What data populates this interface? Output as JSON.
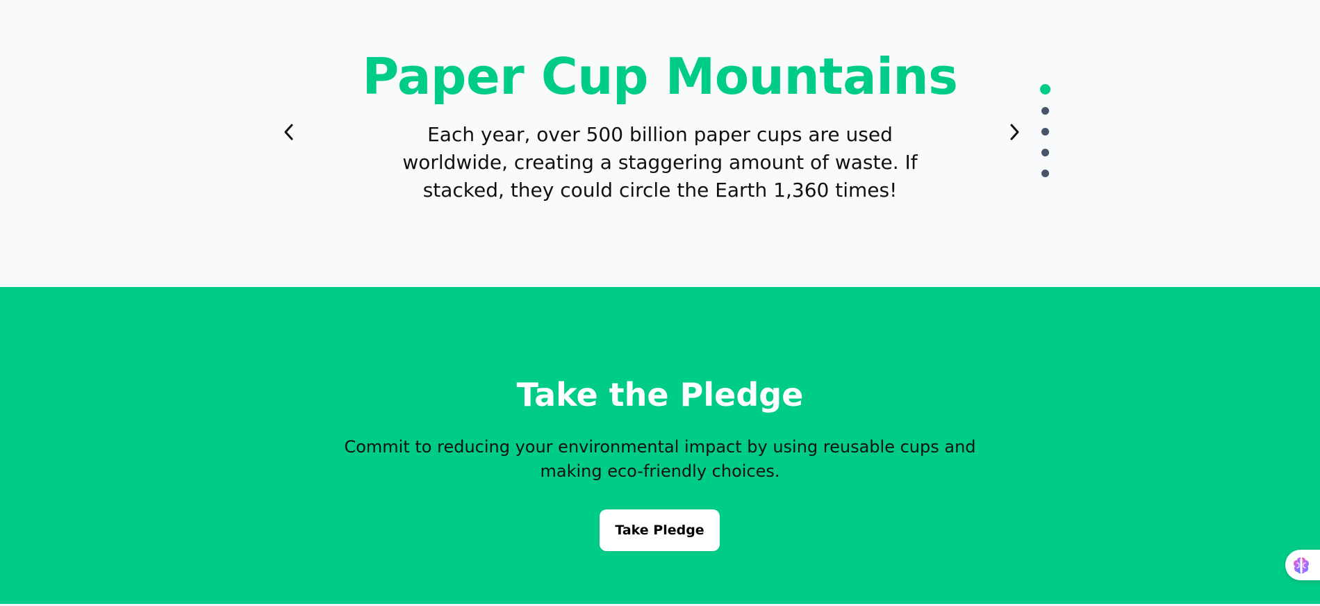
{
  "carousel": {
    "slide_title": "Paper Cup Mountains",
    "slide_text": "Each year, over 500 billion paper cups are used worldwide, creating a staggering amount of waste. If stacked, they could circle the Earth 1,360 times!",
    "prev_icon": "chevron-left-icon",
    "next_icon": "chevron-right-icon",
    "slide_count": 5,
    "active_slide": 1
  },
  "pledge": {
    "title": "Take the Pledge",
    "text": "Commit to reducing your environmental impact by using reusable cups and making eco-friendly choices.",
    "button_label": "Take Pledge"
  },
  "widget": {
    "icon": "brain-icon"
  },
  "colors": {
    "accent": "#00cc8a",
    "carousel_background": "#f8fafc",
    "dot_inactive": "#475569",
    "text": "#111111"
  }
}
